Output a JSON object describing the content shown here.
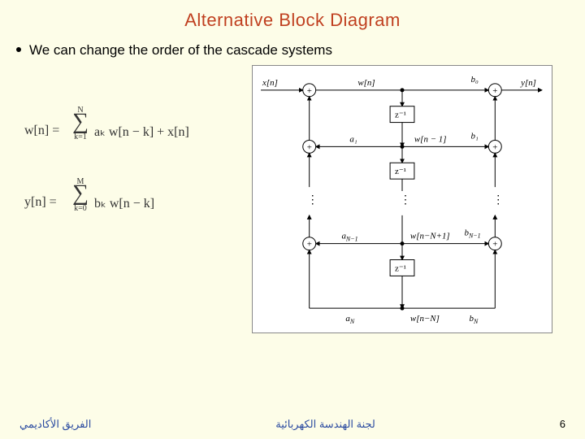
{
  "title": "Alternative Block Diagram",
  "bullet": "We can change the order of the cascade systems",
  "eq1": {
    "lhs": "w[n] =",
    "upper": "N",
    "lower": "k=1",
    "sigma": "∑",
    "rhs": "aₖ w[n − k] + x[n]"
  },
  "eq2": {
    "lhs": "y[n] =",
    "upper": "M",
    "lower": "k=0",
    "sigma": "∑",
    "rhs": "bₖ w[n − k]"
  },
  "diagram": {
    "xin": "x[n]",
    "yout": "y[n]",
    "wn": "w[n]",
    "b0": "b₀",
    "z1": "z⁻¹",
    "a1": "a₁",
    "wn_m1": "w[n − 1]",
    "b1": "b₁",
    "aNm1": "a_{N−1}",
    "wn_Nm1": "w[n − N + 1]",
    "bNm1": "b_{N−1}",
    "aN": "a_N",
    "wn_N": "w[n − N]",
    "bN": "b_N",
    "plus": "+"
  },
  "footer": {
    "left_ar": "الفريق الأكاديمي",
    "center_ar": "لجنة الهندسة الكهربائية",
    "page": "6"
  }
}
